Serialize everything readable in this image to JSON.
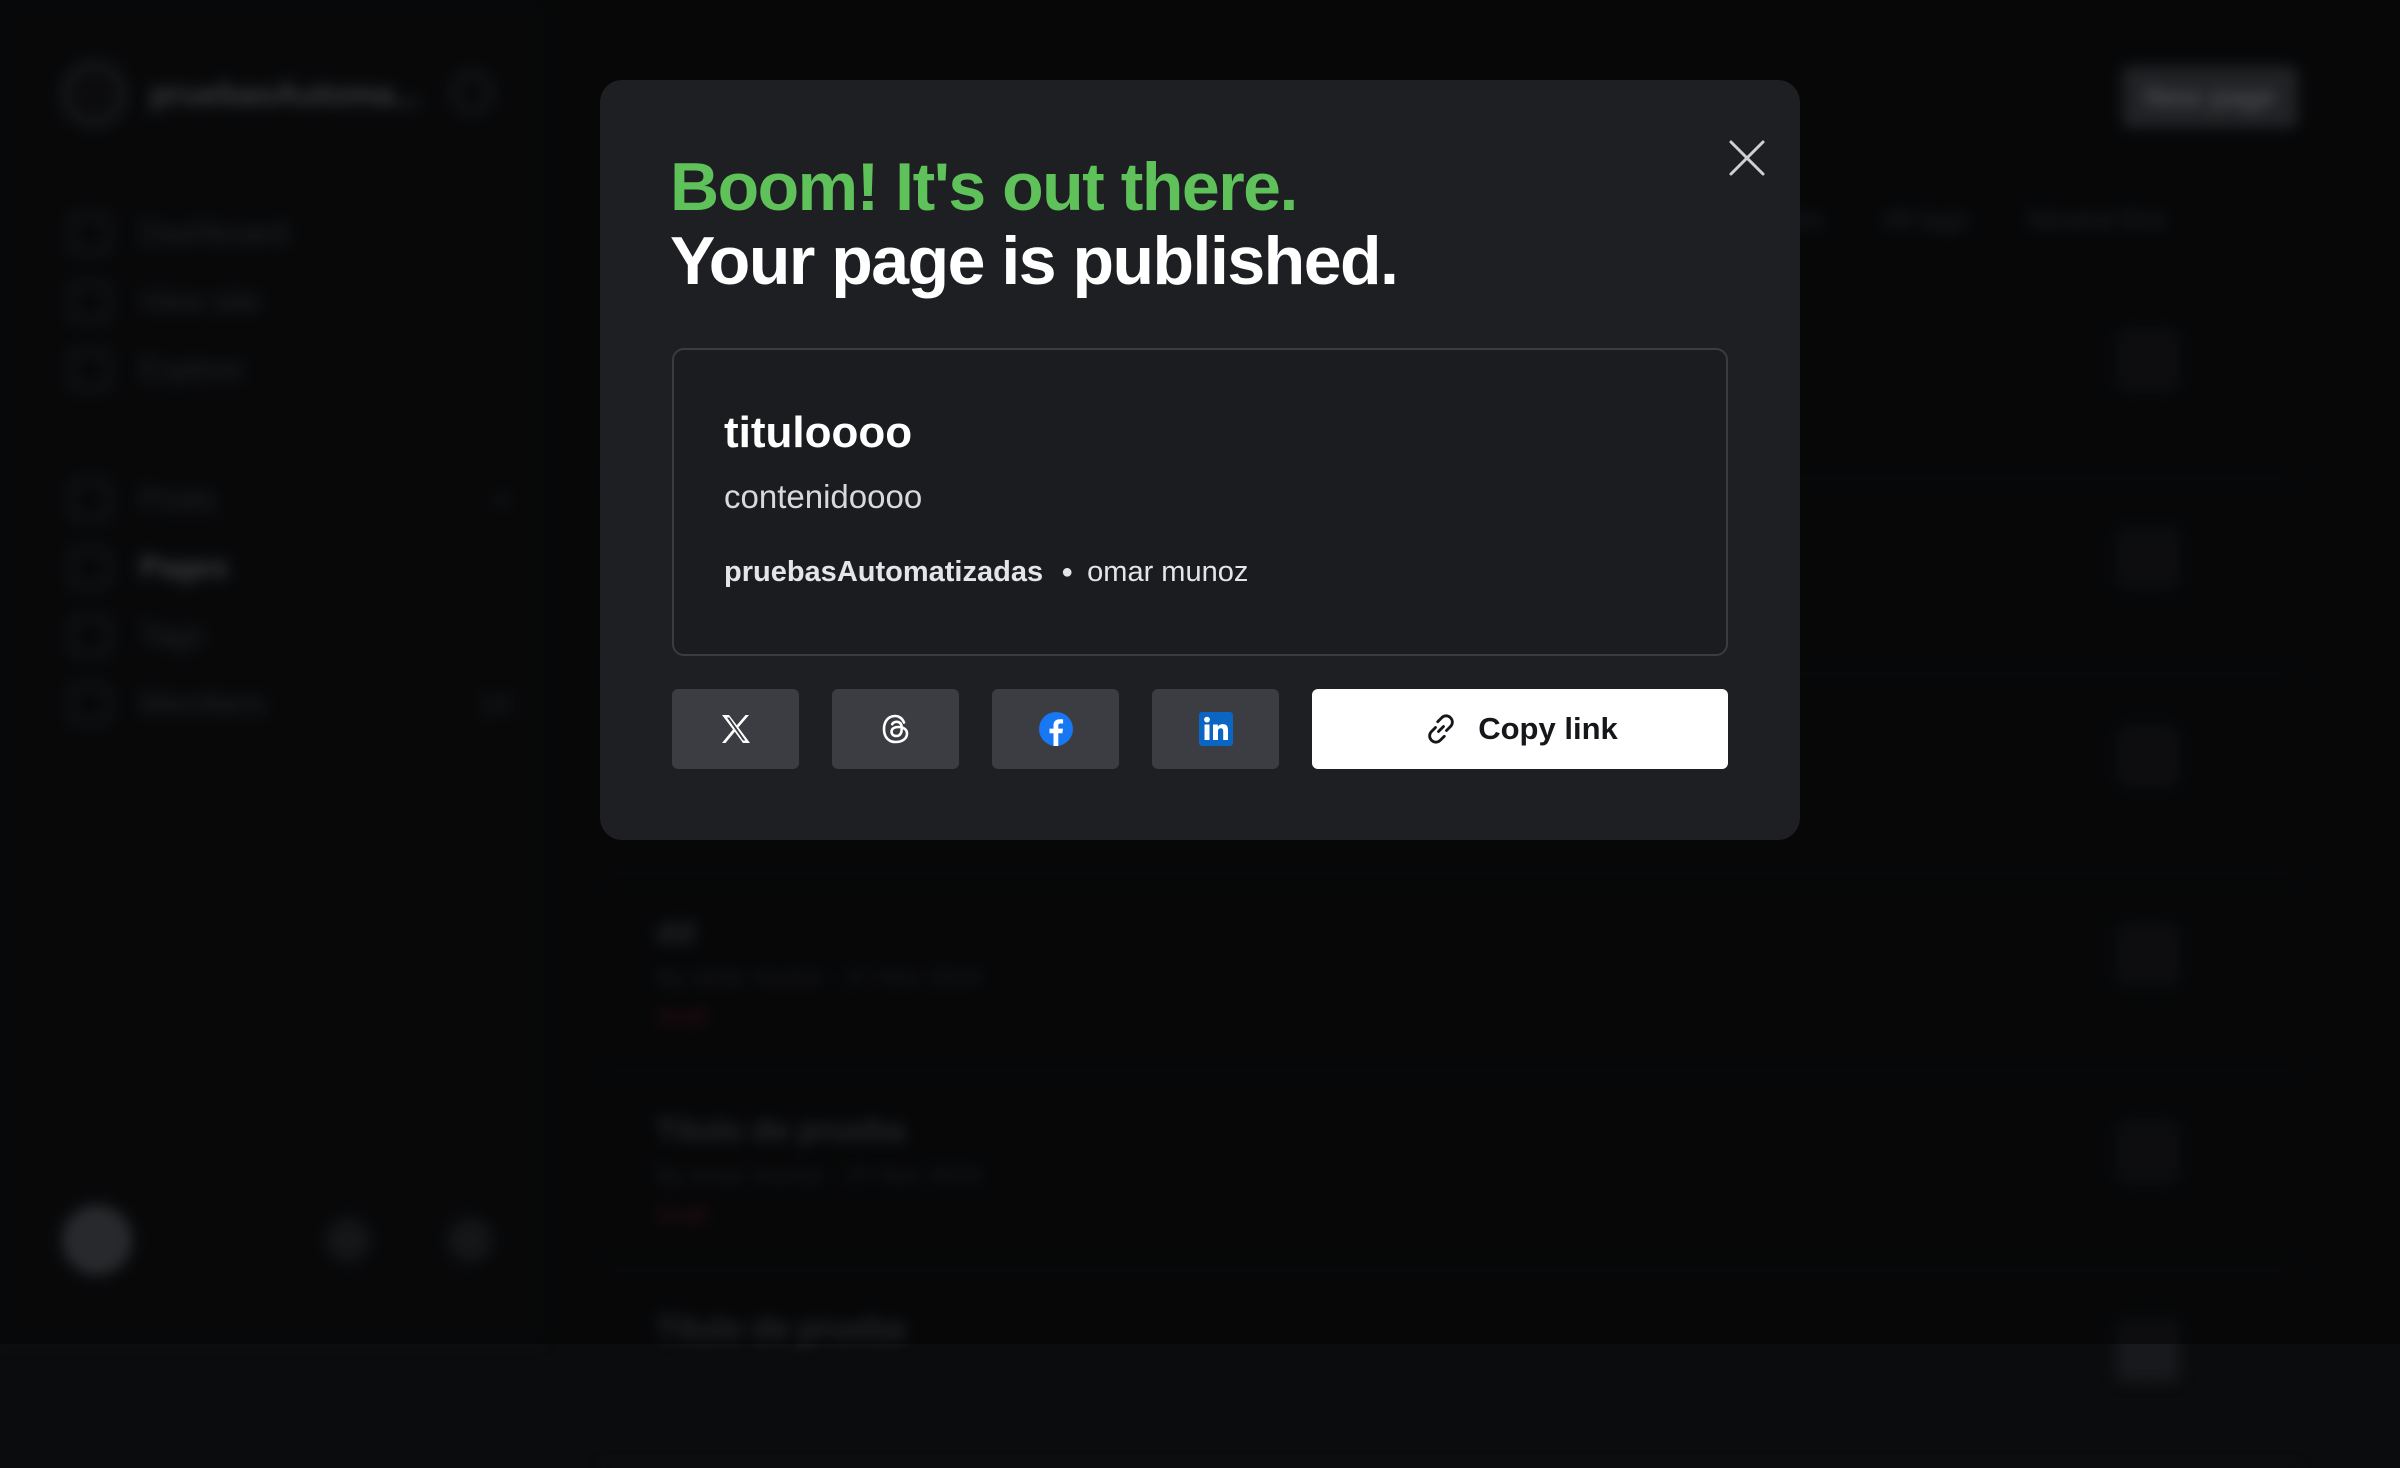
{
  "background": {
    "site_name": "pruebasAutoma...",
    "nav": [
      {
        "label": "Dashboard"
      },
      {
        "label": "View site"
      },
      {
        "label": "Explore"
      }
    ],
    "nav2": [
      {
        "label": "Posts",
        "count": "+"
      },
      {
        "label": "Pages",
        "count": ""
      },
      {
        "label": "Tags",
        "count": ""
      },
      {
        "label": "Members",
        "count": "14"
      }
    ],
    "new_page": "New page",
    "filters": [
      "All authors",
      "All tags",
      "Newest first"
    ],
    "rows": [
      {
        "title": "",
        "meta": "",
        "tag": ""
      },
      {
        "title": "",
        "meta": "",
        "tag": ""
      },
      {
        "title": "",
        "meta": "",
        "tag": ""
      },
      {
        "title": "dd",
        "meta": "By omar munoz · 27 Nov 2024",
        "tag": "Draft"
      },
      {
        "title": "Título de prueba",
        "meta": "By omar munoz · 27 Nov 2024",
        "tag": "Draft"
      },
      {
        "title": "Título de prueba",
        "meta": "",
        "tag": ""
      }
    ]
  },
  "modal": {
    "heading_green": "Boom! It's out there.",
    "heading_white": "Your page is published.",
    "card": {
      "title": "tituloooo",
      "excerpt": "contenidoooo",
      "site": "pruebasAutomatizadas",
      "author": "omar munoz"
    },
    "share_buttons": [
      {
        "name": "x-icon"
      },
      {
        "name": "threads-icon"
      },
      {
        "name": "facebook-icon"
      },
      {
        "name": "linkedin-icon"
      }
    ],
    "copy_link_label": "Copy link"
  },
  "colors": {
    "accent_green": "#5fc15a",
    "modal_bg": "#1e1f22",
    "facebook_blue": "#1877f2",
    "linkedin_blue": "#0a66c2"
  }
}
